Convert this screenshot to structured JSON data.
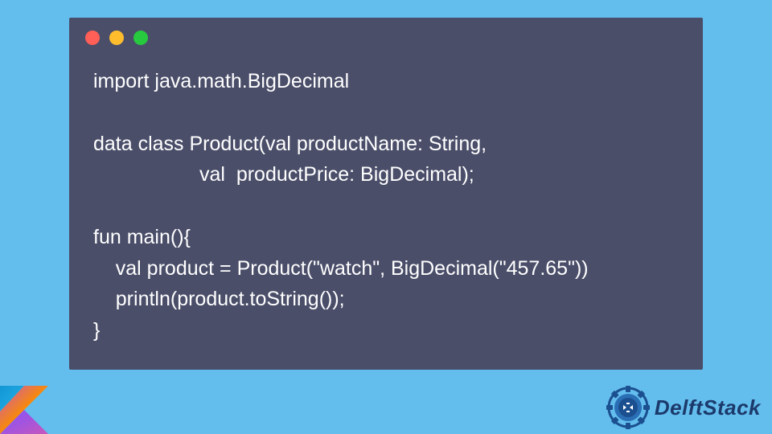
{
  "code": {
    "lines": [
      "import java.math.BigDecimal",
      "",
      "data class Product(val productName: String,",
      "                   val  productPrice: BigDecimal);",
      "",
      "fun main(){",
      "    val product = Product(\"watch\", BigDecimal(\"457.65\"))",
      "    println(product.toString());",
      "}"
    ]
  },
  "window": {
    "buttons": [
      "close",
      "minimize",
      "zoom"
    ]
  },
  "brand": {
    "name": "DelftStack"
  },
  "colors": {
    "background": "#63bded",
    "code_bg": "#4a4e69",
    "code_text": "#ffffff",
    "brand_text": "#1b3a6b"
  }
}
